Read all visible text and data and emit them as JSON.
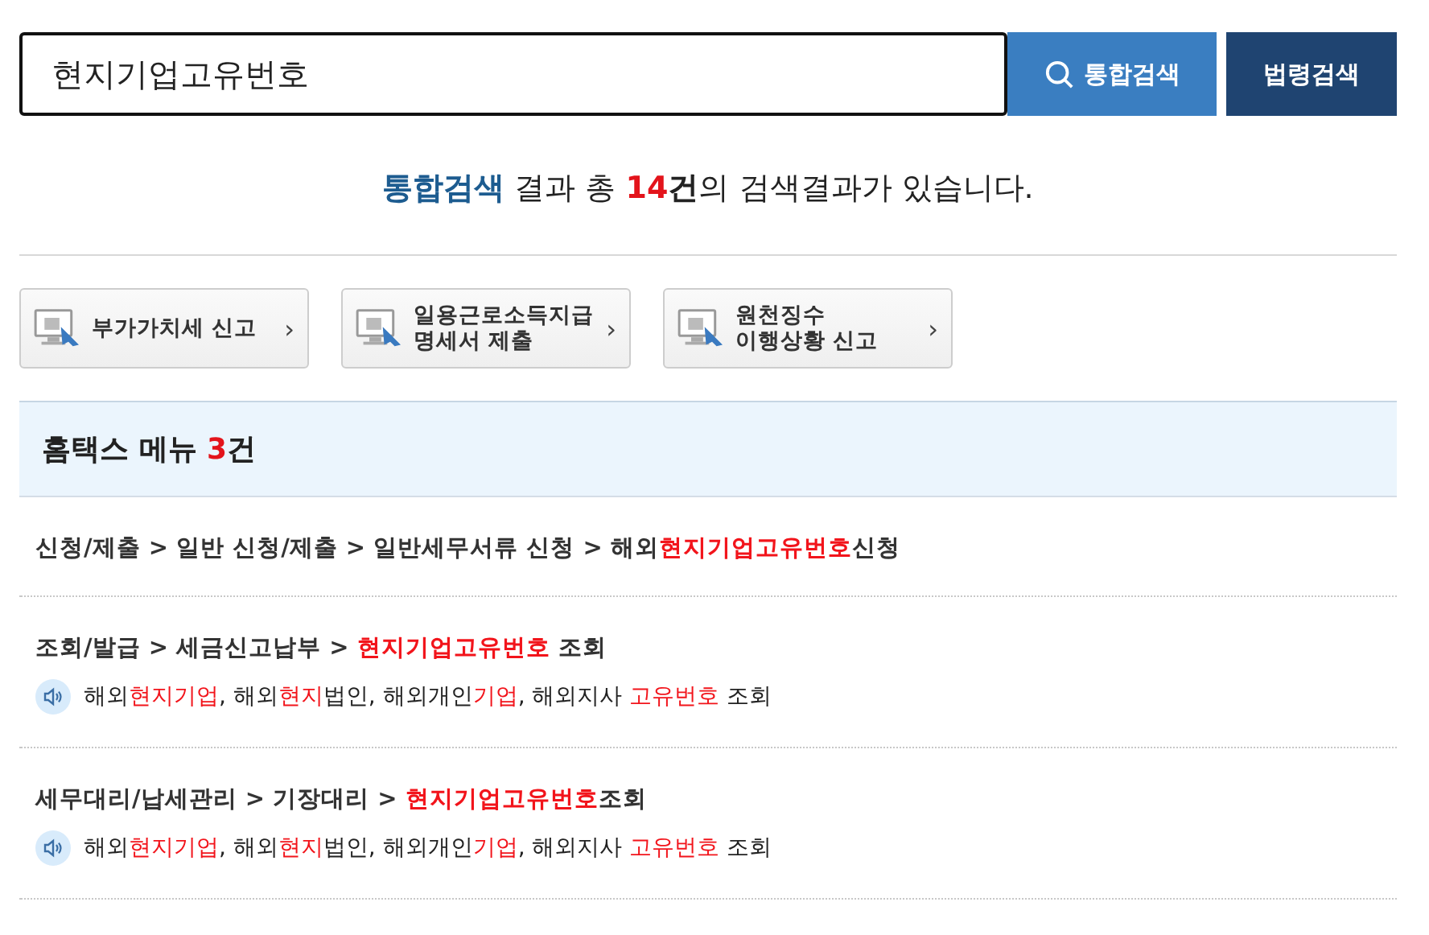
{
  "search": {
    "value": "현지기업고유번호",
    "buttons": [
      {
        "label": "통합검색",
        "kind": "primary"
      },
      {
        "label": "법령검색",
        "kind": "secondary"
      }
    ]
  },
  "summary": [
    {
      "text": "통합검색",
      "kind": "brand"
    },
    {
      "text": " 결과 총 ",
      "kind": "plain"
    },
    {
      "text": "14",
      "kind": "count"
    },
    {
      "text": "건",
      "kind": "strong"
    },
    {
      "text": "의 검색결과가 있습니다.",
      "kind": "plain"
    }
  ],
  "shortcuts": [
    {
      "lines": [
        "부가가치세 신고"
      ],
      "arrow": "›"
    },
    {
      "lines": [
        "일용근로소득지급",
        "명세서 제출"
      ],
      "arrow": "›"
    },
    {
      "lines": [
        "원천징수",
        "이행상황 신고"
      ],
      "arrow": "›"
    }
  ],
  "section": {
    "title": "홈택스 메뉴 ",
    "count": "3",
    "unit": "건"
  },
  "results": [
    {
      "path": [
        {
          "text": "신청/제출 > 일반 신청/제출 > 일반세무서류 신청 > 해외",
          "highlight": false
        },
        {
          "text": "현지기업고유번호",
          "highlight": true
        },
        {
          "text": "신청",
          "highlight": false
        }
      ]
    },
    {
      "path": [
        {
          "text": "조회/발급 > 세금신고납부 > ",
          "highlight": false
        },
        {
          "text": "현지기업고유번호",
          "highlight": true
        },
        {
          "text": " 조회",
          "highlight": false
        }
      ],
      "desc": [
        {
          "text": "해외",
          "highlight": false
        },
        {
          "text": "현지기업",
          "highlight": true
        },
        {
          "text": ", 해외",
          "highlight": false
        },
        {
          "text": "현지",
          "highlight": true
        },
        {
          "text": "법인, 해외개인",
          "highlight": false
        },
        {
          "text": "기업",
          "highlight": true
        },
        {
          "text": ", 해외지사 ",
          "highlight": false
        },
        {
          "text": "고유번호",
          "highlight": true
        },
        {
          "text": " 조회",
          "highlight": false
        }
      ]
    },
    {
      "path": [
        {
          "text": "세무대리/납세관리 > 기장대리 > ",
          "highlight": false
        },
        {
          "text": "현지기업고유번호",
          "highlight": true
        },
        {
          "text": "조회",
          "highlight": false
        }
      ],
      "desc": [
        {
          "text": "해외",
          "highlight": false
        },
        {
          "text": "현지기업",
          "highlight": true
        },
        {
          "text": ", 해외",
          "highlight": false
        },
        {
          "text": "현지",
          "highlight": true
        },
        {
          "text": "법인, 해외개인",
          "highlight": false
        },
        {
          "text": "기업",
          "highlight": true
        },
        {
          "text": ", 해외지사 ",
          "highlight": false
        },
        {
          "text": "고유번호",
          "highlight": true
        },
        {
          "text": " 조회",
          "highlight": false
        }
      ]
    }
  ]
}
